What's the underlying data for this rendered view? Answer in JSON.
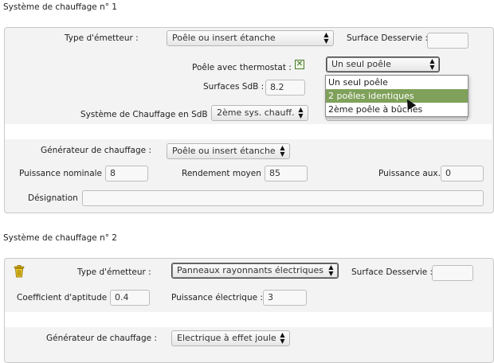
{
  "sections": [
    {
      "title": "Système de chauffage n° 1",
      "labels": {
        "type_emetteur": "Type d'émetteur :",
        "surface_desservie": "Surface Desservie :",
        "poele_thermostat": "Poêle avec thermostat :",
        "surfaces_sdb": "Surfaces SdB :",
        "systeme_sdb": "Système de Chauffage en SdB :",
        "generateur": "Générateur de chauffage :",
        "puissance_nominale": "Puissance nominale",
        "rendement_moyen": "Rendement moyen",
        "puissance_aux": "Puissance aux.",
        "designation": "Désignation"
      },
      "values": {
        "type_emetteur": "Poêle ou insert étanche",
        "surface_desservie": "",
        "poele_type": "Un seul poêle",
        "surfaces_sdb": "8.2",
        "systeme_sdb": "2ème sys. chauff.",
        "generateur": "Poêle ou insert étanche",
        "puissance_nominale": "8",
        "rendement_moyen": "85",
        "puissance_aux": "0",
        "designation": ""
      },
      "thermostat_checked": true,
      "checkbox_glyph": "✕",
      "dropdown": {
        "options": [
          "Un seul poêle",
          "2 poêles identiques",
          "2ème poêle à bûches"
        ],
        "highlighted_index": 1,
        "highlight_color": "#7fa15a"
      }
    },
    {
      "title": "Système de chauffage n° 2",
      "labels": {
        "type_emetteur": "Type d'émetteur :",
        "surface_desservie": "Surface Desservie :",
        "coefficient": "Coefficient d'aptitude",
        "puissance_electrique": "Puissance électrique :",
        "generateur": "Générateur de chauffage :"
      },
      "values": {
        "type_emetteur": "Panneaux rayonnants électriques",
        "surface_desservie": "",
        "coefficient": "0.4",
        "puissance_electrique": "3",
        "generateur": "Electrique à effet joule"
      },
      "delete_icon": "trash-icon",
      "delete_icon_color": "#e0b400"
    }
  ],
  "select_arrow_glyphs": {
    "up": "▲",
    "down": "▼"
  }
}
